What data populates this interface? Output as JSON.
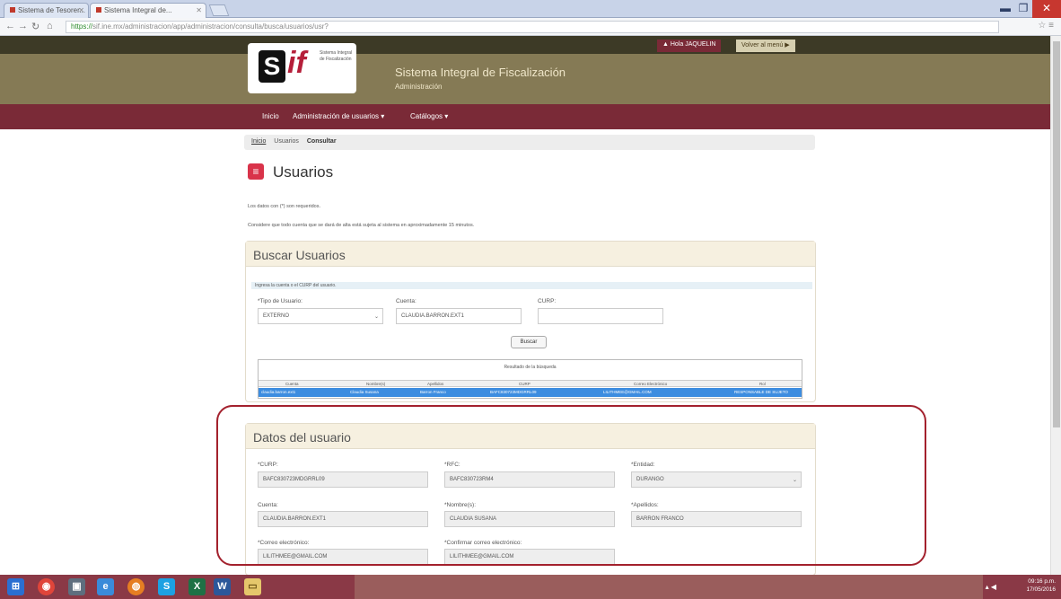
{
  "browser": {
    "tabs": [
      {
        "label": "Sistema de Tesorer...",
        "active": false
      },
      {
        "label": "Sistema Integral de...",
        "active": true
      }
    ],
    "url_scheme": "https://",
    "url_host": "sif.ine.mx",
    "url_path": "/administracion/app/administracion/consulta/busca/usuarios/usr?",
    "back_icon": "back-arrow-icon",
    "forward_icon": "forward-arrow-icon",
    "reload_icon": "reload-icon",
    "home_icon": "home-icon"
  },
  "header": {
    "user_button": "▲ Hola JAQUELIN",
    "back_button": "Volver al menú ▶",
    "logo_letter": "S",
    "logo_if": "if",
    "logo_text": "Sistema Integral de Fiscalización",
    "system_name": "Sistema Integral de Fiscalización",
    "system_sub": "Administración"
  },
  "menu": {
    "items": [
      "Inicio",
      "Administración de usuarios ▾",
      "Catálogos ▾"
    ]
  },
  "breadcrumb": {
    "items": [
      "Inicio",
      "Usuarios",
      "Consultar"
    ]
  },
  "page": {
    "title": "Usuarios",
    "icon": "list-icon",
    "note1": "Los datos con (*) son requeridos.",
    "note2": "Considere que todo cuenta que se dará de alta está sujeta al sistema en aproximadamente 15 minutos."
  },
  "search": {
    "panel_title": "Buscar Usuarios",
    "hint": "Ingresa la cuenta o el CURP del usuario.",
    "tipo_label": "*Tipo de Usuario:",
    "tipo_value": "EXTERNO",
    "cuenta_label": "Cuenta:",
    "cuenta_value": "CLAUDIA.BARRON.EXT1",
    "curp_label": "CURP:",
    "curp_value": "",
    "buscar_button": "Buscar"
  },
  "results": {
    "title": "Resultado de la búsqueda",
    "columns": [
      "Cuenta",
      "Nombre(s)",
      "Apellidos",
      "CURP",
      "Correo Electrónico",
      "Rol"
    ],
    "rows": [
      [
        "claudia.barron.ext1",
        "Claudia Susana",
        "Barron Franco",
        "BAFC830723MDGRRL09",
        "LILITHMEE@GMAIL.COM",
        "RESPONSABLE DE SUJETO"
      ]
    ]
  },
  "datos": {
    "panel_title": "Datos del usuario",
    "curp_label": "*CURP:",
    "curp_value": "BAFC830723MDGRRL09",
    "rfc_label": "*RFC:",
    "rfc_value": "BAFC830723RM4",
    "entidad_label": "*Entidad:",
    "entidad_value": "DURANGO",
    "cuenta_label": "Cuenta:",
    "cuenta_value": "CLAUDIA.BARRON.EXT1",
    "nombre_label": "*Nombre(s):",
    "nombre_value": "CLAUDIA SUSANA",
    "apellidos_label": "*Apellidos:",
    "apellidos_value": "BARRON FRANCO",
    "correo_label": "*Correo electrónico:",
    "correo_value": "LILITHMEE@GMAIL.COM",
    "confirmar_label": "*Confirmar correo electrónico:",
    "confirmar_value": "LILITHMEE@GMAIL.COM"
  },
  "taskbar": {
    "time": "09:16 p.m.",
    "date": "17/05/2016",
    "tray": "▴ ◀"
  },
  "colors": {
    "banner": "#857a55",
    "menubar": "#7a2a37",
    "accent": "#d9334a",
    "selected_row": "#3d8de0"
  }
}
